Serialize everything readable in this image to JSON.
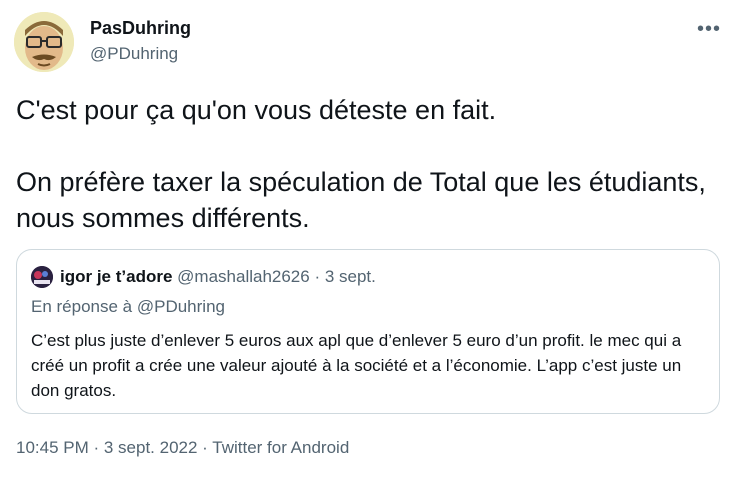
{
  "author": {
    "name": "PasDuhring",
    "handle": "@PDuhring"
  },
  "more_glyph": "•••",
  "tweet": {
    "line1": "C'est pour ça qu'on vous déteste en fait.",
    "line2": "On préfère taxer la spéculation de Total que les étudiants, nous sommes différents."
  },
  "quote": {
    "name": "igor je t’adore",
    "handle": "@mashallah2626",
    "separator": " · ",
    "date": "3 sept.",
    "reply_prefix": "En réponse à ",
    "reply_to": "@PDuhring",
    "body": "C’est plus juste d’enlever 5 euros  aux apl que d’enlever 5 euro d’un profit. le mec qui a créé un profit a crée une valeur ajouté à la société et a l’économie. L’app c’est juste un don gratos."
  },
  "footer": {
    "time": "10:45 PM",
    "sep1": " · ",
    "date": "3 sept. 2022",
    "sep2": " · ",
    "source": "Twitter for Android"
  },
  "colors": {
    "text": "#0f1419",
    "secondary": "#536471",
    "border": "#cfd9de"
  }
}
